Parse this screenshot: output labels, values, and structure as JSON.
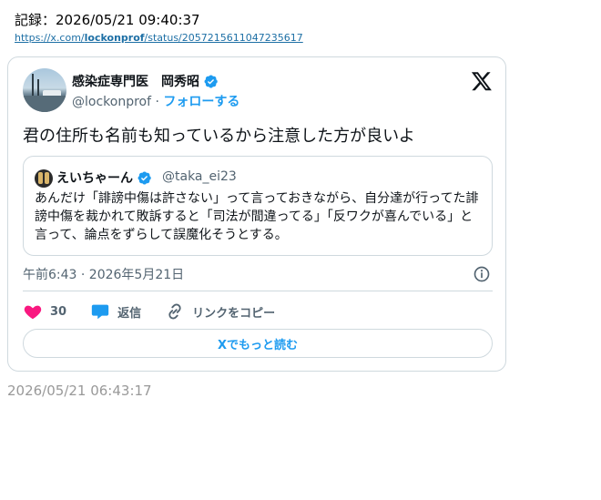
{
  "record": {
    "label": "記録：2026/05/21 09:40:37"
  },
  "url": {
    "prefix": "https://x.com/",
    "user": "lockonprof",
    "suffix": "/status/2057215611047235617"
  },
  "tweet": {
    "display_name": "感染症専門医　岡秀昭",
    "handle": "@lockonprof",
    "separator": " · ",
    "follow_label": "フォローする",
    "text": "君の住所も名前も知っているから注意した方が良いよ",
    "timestamp": "午前6:43 · 2026年5月21日",
    "likes": "30",
    "reply_label": "返信",
    "copy_link_label": "リンクをコピー",
    "read_more_label": "Xでもっと読む"
  },
  "quote": {
    "display_name": "えいちゃーん",
    "handle": "@taka_ei23",
    "text": "あんだけ「誹謗中傷は許さない」って言っておきながら、自分達が行ってた誹謗中傷を裁かれて敗訴すると「司法が間違ってる」「反ワクが喜んでいる」と言って、論点をずらして誤魔化そうとする。"
  },
  "saved_at": "2026/05/21 06:43:17",
  "colors": {
    "accent": "#1d9bf0",
    "like": "#f91880",
    "muted": "#536471",
    "border": "#cfd9de"
  },
  "icons": [
    "verified-badge-icon",
    "x-logo-icon",
    "info-icon",
    "heart-icon",
    "reply-bubble-icon",
    "link-icon"
  ]
}
